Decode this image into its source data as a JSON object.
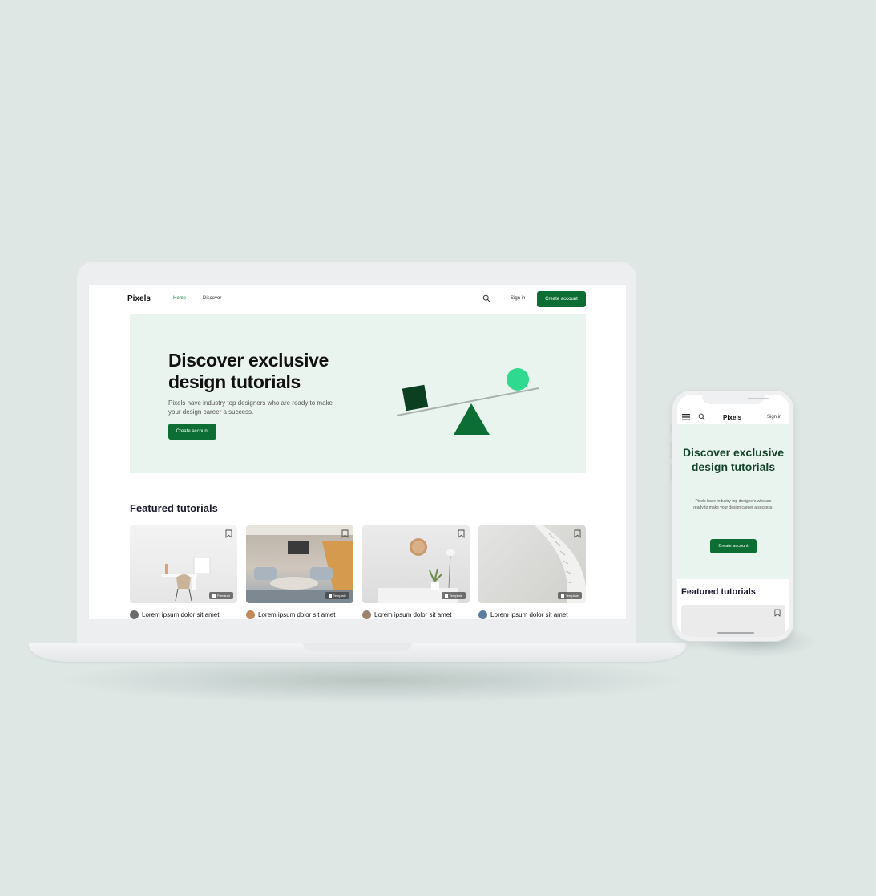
{
  "desktop": {
    "logo": "Pixels",
    "nav": {
      "home": "Home",
      "discover": "Discover"
    },
    "signin": "Sign in",
    "create_account": "Create account",
    "hero": {
      "title": "Discover exclusive design tutorials",
      "subtitle": "Pixels have industry top designers who are ready to make your design career a success.",
      "button": "Create account"
    },
    "featured": {
      "title": "Featured tutorials",
      "cards": [
        {
          "title": "Lorem ipsum dolor sit amet",
          "badge": "Premium"
        },
        {
          "title": "Lorem ipsum dolor sit amet",
          "badge": "Template"
        },
        {
          "title": "Lorem ipsum dolor sit amet",
          "badge": "Template"
        },
        {
          "title": "Lorem ipsum dolor sit amet",
          "badge": "Template"
        }
      ]
    }
  },
  "mobile": {
    "logo": "Pixels",
    "signin": "Sign in",
    "hero": {
      "title": "Discover exclusive design tutorials",
      "subtitle": "Pixels have industry top designers who are ready to make your design career a success.",
      "button": "Create account"
    },
    "featured_title": "Featured tutorials"
  },
  "colors": {
    "brand_green": "#0d6e35",
    "hero_bg": "#e9f4ef",
    "accent_mint": "#2fd98f",
    "background": "#dfe7e5"
  },
  "icons": [
    "search-icon",
    "bookmark-icon",
    "menu-icon",
    "template-icon"
  ]
}
